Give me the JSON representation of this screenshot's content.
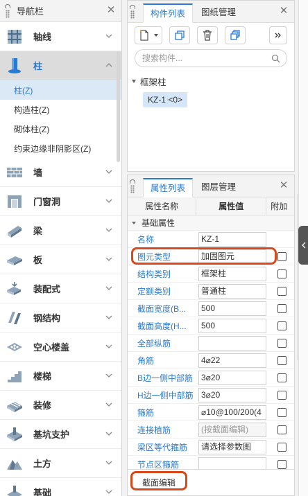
{
  "nav": {
    "title": "导航栏",
    "items_top": [
      {
        "label": "轴线",
        "icon": "axis-grid-icon"
      },
      {
        "label": "柱",
        "icon": "column-icon",
        "active": true
      }
    ],
    "sub_items": [
      {
        "label": "柱(Z)",
        "selected": true
      },
      {
        "label": "构造柱(Z)"
      },
      {
        "label": "砌体柱(Z)"
      },
      {
        "label": "约束边缘非阴影区(Z)"
      }
    ],
    "items_bottom": [
      {
        "label": "墙",
        "icon": "wall-icon"
      },
      {
        "label": "门窗洞",
        "icon": "door-window-icon"
      },
      {
        "label": "梁",
        "icon": "beam-icon"
      },
      {
        "label": "板",
        "icon": "slab-icon"
      },
      {
        "label": "装配式",
        "icon": "prefab-icon"
      },
      {
        "label": "钢结构",
        "icon": "steel-structure-icon"
      },
      {
        "label": "空心楼盖",
        "icon": "hollow-floor-icon"
      },
      {
        "label": "楼梯",
        "icon": "stairs-icon"
      },
      {
        "label": "装修",
        "icon": "decoration-icon"
      },
      {
        "label": "基坑支护",
        "icon": "foundation-pit-icon"
      },
      {
        "label": "土方",
        "icon": "earthwork-icon"
      },
      {
        "label": "基础",
        "icon": "foundation-icon"
      }
    ]
  },
  "components": {
    "tabs": [
      "构件列表",
      "图纸管理"
    ],
    "search_placeholder": "搜索构件...",
    "tree_group": "框架柱",
    "tree_item": "KZ-1 <0>"
  },
  "properties": {
    "tabs": [
      "属性列表",
      "图层管理"
    ],
    "headers": {
      "name": "属性名称",
      "value": "属性值",
      "add": "附加"
    },
    "group": "基础属性",
    "rows": [
      {
        "name": "名称",
        "value": "KZ-1",
        "checkbox": false,
        "gray": false
      },
      {
        "name": "图元类型",
        "value": "加固图元",
        "checkbox": true,
        "gray": false
      },
      {
        "name": "结构类别",
        "value": "框架柱",
        "checkbox": true,
        "gray": false
      },
      {
        "name": "定额类别",
        "value": "普通柱",
        "checkbox": true,
        "gray": false
      },
      {
        "name": "截面宽度(B...",
        "value": "500",
        "checkbox": true,
        "gray": false
      },
      {
        "name": "截面高度(H...",
        "value": "500",
        "checkbox": true,
        "gray": false
      },
      {
        "name": "全部纵筋",
        "value": "",
        "checkbox": true,
        "gray": false
      },
      {
        "name": "角筋",
        "value": "4⌀22",
        "checkbox": true,
        "gray": false
      },
      {
        "name": "B边一侧中部筋",
        "value": "3⌀20",
        "checkbox": true,
        "gray": false
      },
      {
        "name": "H边一侧中部筋",
        "value": "3⌀20",
        "checkbox": true,
        "gray": false
      },
      {
        "name": "箍筋",
        "value": "⌀10@100/200(4",
        "checkbox": true,
        "gray": false
      },
      {
        "name": "连接植筋",
        "value": "(按截面编辑)",
        "checkbox": true,
        "gray": true
      },
      {
        "name": "梁区等代箍筋",
        "value": "请选择参数图",
        "checkbox": true,
        "gray": false
      },
      {
        "name": "节点区箍筋",
        "value": "",
        "checkbox": true,
        "gray": false
      }
    ]
  },
  "bottom_button": "截面编辑",
  "colors": {
    "accent": "#2a7ad2",
    "highlight": "#d9481c"
  }
}
